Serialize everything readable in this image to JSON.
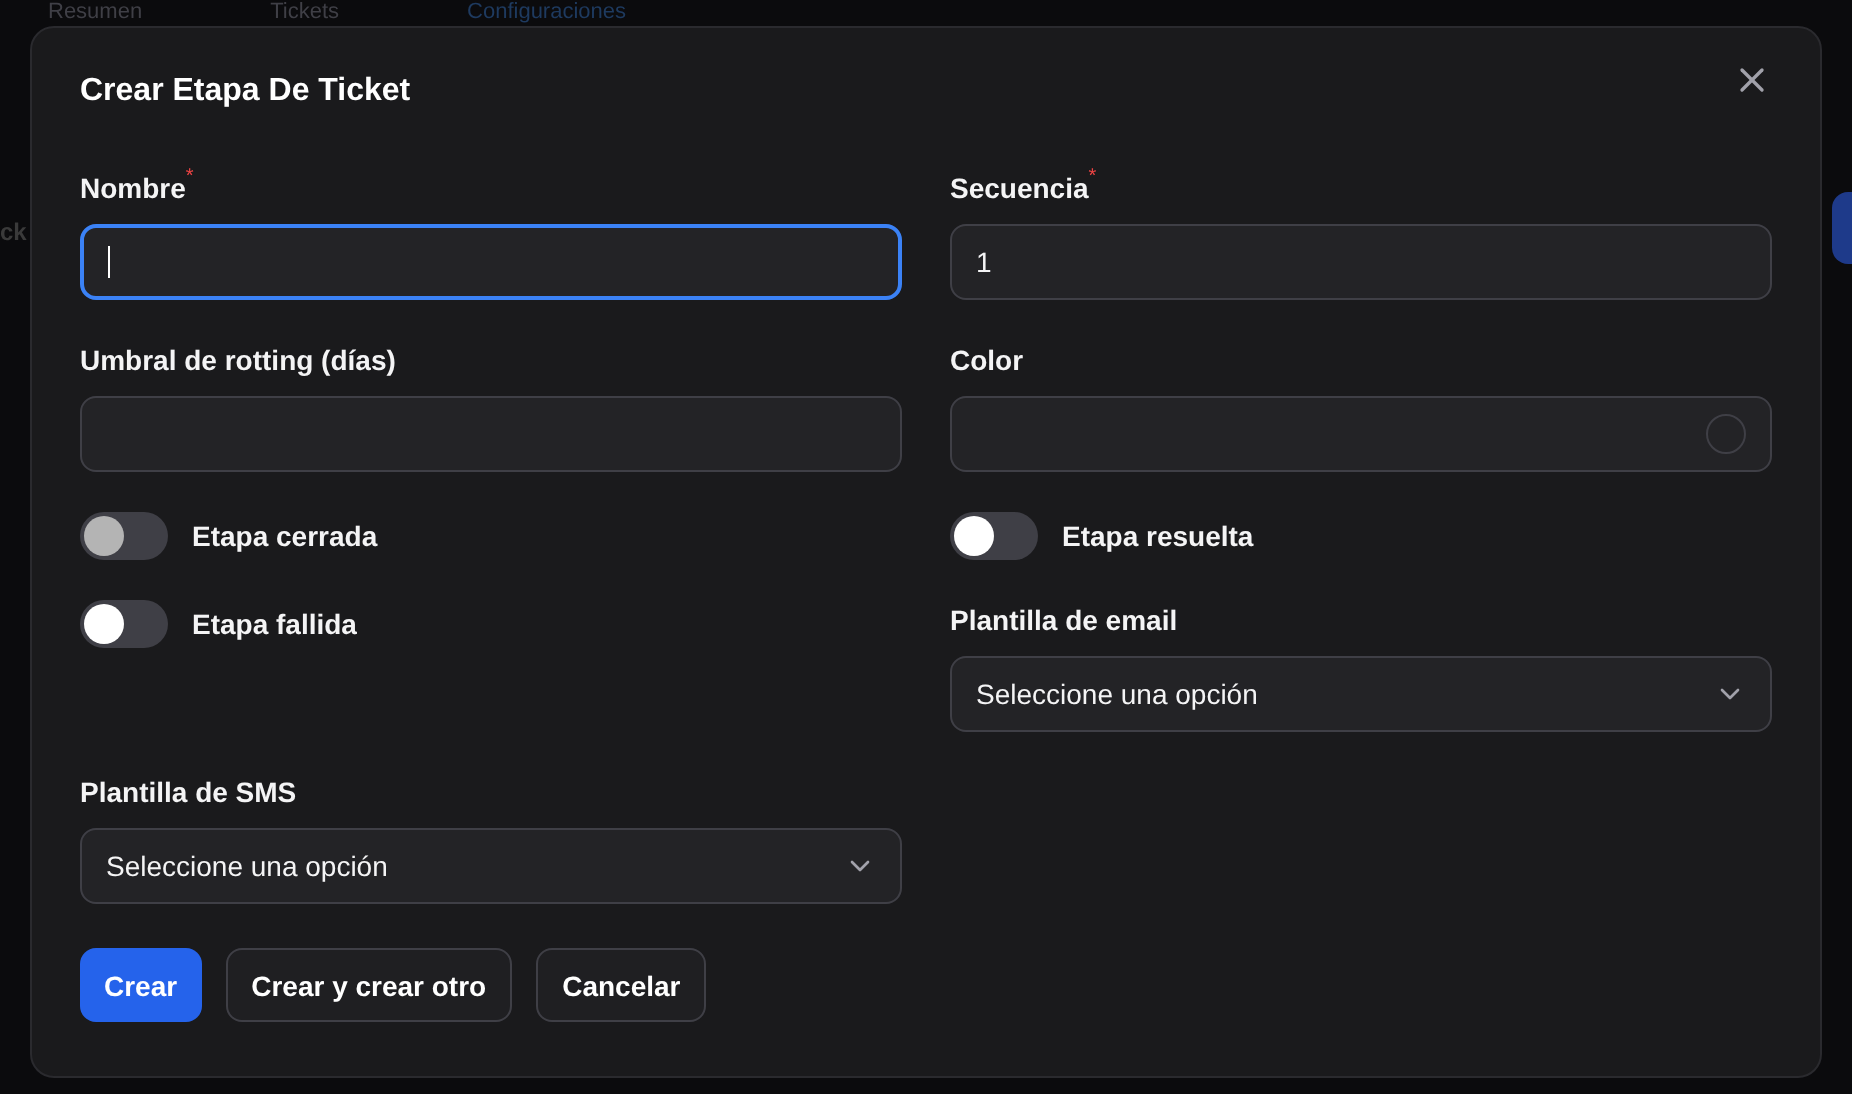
{
  "background": {
    "tabs": [
      {
        "label": "Resumen",
        "selected": false
      },
      {
        "label": "Tickets",
        "selected": false
      },
      {
        "label": "Configuraciones",
        "selected": true
      }
    ],
    "heading": "ck"
  },
  "dialog": {
    "title": "Crear Etapa De Ticket",
    "fields": [
      {
        "kind": "text",
        "label": "Nombre",
        "required_mark": "*",
        "focused": true
      },
      {
        "kind": "text",
        "label": "Secuencia",
        "required_mark": "*",
        "value": "1",
        "focused": false
      },
      {
        "kind": "text",
        "label": "Umbral de rotting (días)",
        "focused": false
      },
      {
        "kind": "color",
        "label": "Color"
      },
      {
        "kind": "toggle",
        "label": "Etapa cerrada",
        "on": false,
        "disabled": true
      },
      {
        "kind": "toggle",
        "label": "Etapa resuelta",
        "on": false,
        "disabled": false
      },
      {
        "kind": "toggle",
        "label": "Etapa fallida",
        "on": false,
        "disabled": false
      },
      {
        "kind": "select",
        "label": "Plantilla de email",
        "value": "Seleccione una opción"
      },
      {
        "kind": "select",
        "label": "Plantilla de SMS",
        "value": "Seleccione una opción"
      }
    ],
    "buttons": [
      {
        "label": "Crear",
        "kind": "primary"
      },
      {
        "label": "Crear y crear otro",
        "kind": "secondary"
      },
      {
        "label": "Cancelar",
        "kind": "secondary"
      }
    ]
  }
}
